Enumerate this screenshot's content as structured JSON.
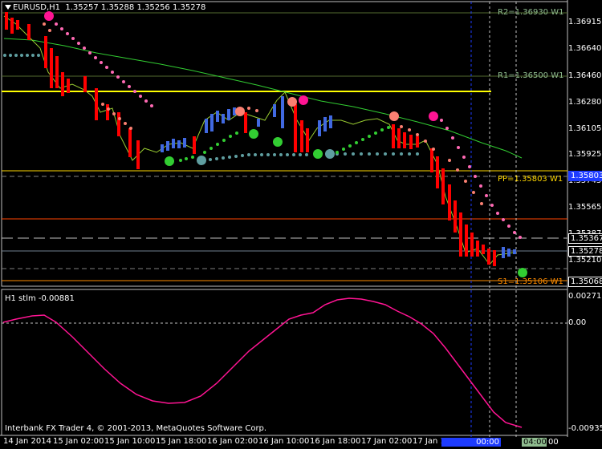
{
  "symbol_title": "EURUSD,H1",
  "ohlc": "1.35257 1.35288 1.35256 1.35278",
  "indicator_title": "H1 stlm -0.00881",
  "copyright": "Interbank FX Trader 4, © 2001-2013, MetaQuotes Software Corp.",
  "pivots": [
    {
      "label": "R2=1.36930 W1",
      "value": 1.3693,
      "color": "#8fbc8f"
    },
    {
      "label": "R1=1.36500 W1",
      "value": 1.365,
      "color": "#8fbc8f"
    },
    {
      "label": "PP=1.35803 W1",
      "value": 1.35803,
      "color": "#ffd700"
    },
    {
      "label": "S1=1.35106 W1",
      "value": 1.35106,
      "color": "#ff8c00"
    }
  ],
  "price_axis": [
    "1.36915",
    "1.36640",
    "1.36460",
    "1.36280",
    "1.36105",
    "1.35925",
    "1.35745",
    "1.35565",
    "1.35387",
    "1.35210"
  ],
  "price_badges": [
    {
      "text": "1.35367",
      "bg": "#000000",
      "fg": "#ffffff",
      "border": "#ffffff",
      "value": 1.35367
    },
    {
      "text": "1.35278",
      "bg": "#000000",
      "fg": "#ffffff",
      "border": "#ffffff",
      "value": 1.35278
    },
    {
      "text": "1.35068",
      "bg": "#000000",
      "fg": "#ffffff",
      "border": "#ffffff",
      "value": 1.35068
    },
    {
      "text": "1.35803",
      "bg": "#1e3cff",
      "fg": "#ffffff",
      "border": "#1e3cff",
      "value": 1.35803
    }
  ],
  "indicator_axis": [
    "0.00271",
    "0.00",
    "-0.00935"
  ],
  "time_axis": [
    "14 Jan 2014",
    "15 Jan 02:00",
    "15 Jan 10:00",
    "15 Jan 18:00",
    "16 Jan 02:00",
    "16 Jan 10:00",
    "16 Jan 18:00",
    "17 Jan 02:00",
    "17 Jan 1"
  ],
  "time_badges": [
    {
      "text": "00:00",
      "bg": "#1e3cff"
    },
    {
      "text": "04:00",
      "bg": "#8fbc8f"
    },
    {
      "text": "00",
      "bg": "#000000"
    }
  ],
  "colors": {
    "bull": "#4169e1",
    "bear": "#ff0000",
    "ma": "#32cd32",
    "stlm": "#ff1493",
    "grid": "#c0c0c0"
  }
}
